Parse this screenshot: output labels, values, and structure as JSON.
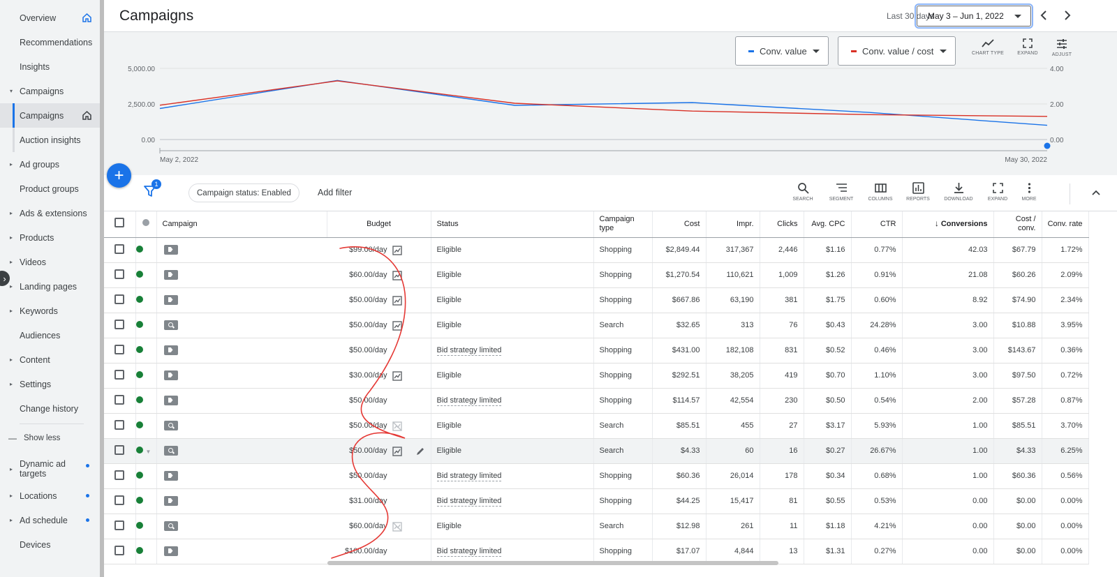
{
  "sidebar": {
    "items": [
      {
        "label": "Overview",
        "caret": false
      },
      {
        "label": "Recommendations",
        "caret": false
      },
      {
        "label": "Insights",
        "caret": false
      },
      {
        "label": "Campaigns",
        "caret": true,
        "expanded": true
      },
      {
        "label": "Campaigns",
        "caret": false,
        "active": true
      },
      {
        "label": "Auction insights",
        "caret": false
      },
      {
        "label": "Ad groups",
        "caret": true
      },
      {
        "label": "Product groups",
        "caret": false
      },
      {
        "label": "Ads & extensions",
        "caret": true
      },
      {
        "label": "Products",
        "caret": true
      },
      {
        "label": "Videos",
        "caret": true
      },
      {
        "label": "Landing pages",
        "caret": true
      },
      {
        "label": "Keywords",
        "caret": true
      },
      {
        "label": "Audiences",
        "caret": false
      },
      {
        "label": "Content",
        "caret": true
      },
      {
        "label": "Settings",
        "caret": true
      },
      {
        "label": "Change history",
        "caret": false
      }
    ],
    "show_less": "Show less",
    "lower_items": [
      {
        "label": "Dynamic ad targets",
        "dot": true
      },
      {
        "label": "Locations",
        "dot": true
      },
      {
        "label": "Ad schedule",
        "dot": true
      },
      {
        "label": "Devices",
        "dot": false
      }
    ]
  },
  "header": {
    "title": "Campaigns",
    "date_label": "Last 30 days",
    "date_range": "May 3 – Jun 1, 2022"
  },
  "chart_controls": {
    "metric1": "Conv. value",
    "metric1_color": "#1a73e8",
    "metric2": "Conv. value / cost",
    "metric2_color": "#d93025",
    "tools": [
      "CHART TYPE",
      "EXPAND",
      "ADJUST"
    ]
  },
  "chart_data": {
    "type": "line",
    "x_labels": [
      "May 2, 2022",
      "May 30, 2022"
    ],
    "x": [
      0,
      1,
      2,
      3,
      4,
      5
    ],
    "left_ticks": [
      "5,000.00",
      "2,500.00",
      "0.00"
    ],
    "right_ticks": [
      "4.00",
      "2.00",
      "0.00"
    ],
    "left_ylim": [
      0,
      5000
    ],
    "right_ylim": [
      0,
      4
    ],
    "series": [
      {
        "name": "Conv. value",
        "color": "#1a73e8",
        "axis": "left",
        "values": [
          2180,
          4150,
          2400,
          2600,
          1900,
          1000
        ]
      },
      {
        "name": "Conv. value / cost",
        "color": "#d93025",
        "axis": "right",
        "values": [
          1.93,
          3.3,
          2.04,
          1.6,
          1.4,
          1.3
        ]
      }
    ]
  },
  "toolbar": {
    "filter_count": "1",
    "chip": "Campaign status: Enabled",
    "add_filter": "Add filter",
    "tools": [
      "SEARCH",
      "SEGMENT",
      "COLUMNS",
      "REPORTS",
      "DOWNLOAD",
      "EXPAND",
      "MORE"
    ]
  },
  "table": {
    "headers": {
      "campaign": "Campaign",
      "budget": "Budget",
      "status": "Status",
      "type1": "Campaign",
      "type2": "type",
      "cost": "Cost",
      "impr": "Impr.",
      "clicks": "Clicks",
      "cpc": "Avg. CPC",
      "ctr": "CTR",
      "conversions": "Conversions",
      "cpconv1": "Cost /",
      "cpconv2": "conv.",
      "convrate": "Conv. rate"
    },
    "rows": [
      {
        "icon": "tag",
        "budget": "$99.00/day",
        "bicon": "chart",
        "status": "Eligible",
        "type": "Shopping",
        "cost": "$2,849.44",
        "impr": "317,367",
        "clicks": "2,446",
        "cpc": "$1.16",
        "ctr": "0.77%",
        "conv": "42.03",
        "cpconv": "$67.79",
        "rate": "1.72%"
      },
      {
        "icon": "tag",
        "budget": "$60.00/day",
        "bicon": "chart",
        "status": "Eligible",
        "type": "Shopping",
        "cost": "$1,270.54",
        "impr": "110,621",
        "clicks": "1,009",
        "cpc": "$1.26",
        "ctr": "0.91%",
        "conv": "21.08",
        "cpconv": "$60.26",
        "rate": "2.09%"
      },
      {
        "icon": "tag",
        "budget": "$50.00/day",
        "bicon": "chart",
        "status": "Eligible",
        "type": "Shopping",
        "cost": "$667.86",
        "impr": "63,190",
        "clicks": "381",
        "cpc": "$1.75",
        "ctr": "0.60%",
        "conv": "8.92",
        "cpconv": "$74.90",
        "rate": "2.34%"
      },
      {
        "icon": "search",
        "budget": "$50.00/day",
        "bicon": "chart",
        "status": "Eligible",
        "type": "Search",
        "cost": "$32.65",
        "impr": "313",
        "clicks": "76",
        "cpc": "$0.43",
        "ctr": "24.28%",
        "conv": "3.00",
        "cpconv": "$10.88",
        "rate": "3.95%"
      },
      {
        "icon": "tag",
        "budget": "$50.00/day",
        "bicon": "",
        "status": "Bid strategy limited",
        "type": "Shopping",
        "cost": "$431.00",
        "impr": "182,108",
        "clicks": "831",
        "cpc": "$0.52",
        "ctr": "0.46%",
        "conv": "3.00",
        "cpconv": "$143.67",
        "rate": "0.36%"
      },
      {
        "icon": "tag",
        "budget": "$30.00/day",
        "bicon": "chart",
        "status": "Eligible",
        "type": "Shopping",
        "cost": "$292.51",
        "impr": "38,205",
        "clicks": "419",
        "cpc": "$0.70",
        "ctr": "1.10%",
        "conv": "3.00",
        "cpconv": "$97.50",
        "rate": "0.72%"
      },
      {
        "icon": "tag",
        "budget": "$50.00/day",
        "bicon": "",
        "status": "Bid strategy limited",
        "type": "Shopping",
        "cost": "$114.57",
        "impr": "42,554",
        "clicks": "230",
        "cpc": "$0.50",
        "ctr": "0.54%",
        "conv": "2.00",
        "cpconv": "$57.28",
        "rate": "0.87%"
      },
      {
        "icon": "search",
        "budget": "$50.00/day",
        "bicon": "nochart",
        "status": "Eligible",
        "type": "Search",
        "cost": "$85.51",
        "impr": "455",
        "clicks": "27",
        "cpc": "$3.17",
        "ctr": "5.93%",
        "conv": "1.00",
        "cpconv": "$85.51",
        "rate": "3.70%"
      },
      {
        "icon": "search",
        "budget": "$50.00/day",
        "bicon": "chart",
        "status": "Eligible",
        "type": "Search",
        "cost": "$4.33",
        "impr": "60",
        "clicks": "16",
        "cpc": "$0.27",
        "ctr": "26.67%",
        "conv": "1.00",
        "cpconv": "$4.33",
        "rate": "6.25%",
        "hl": true
      },
      {
        "icon": "tag",
        "budget": "$50.00/day",
        "bicon": "",
        "status": "Bid strategy limited",
        "type": "Shopping",
        "cost": "$60.36",
        "impr": "26,014",
        "clicks": "178",
        "cpc": "$0.34",
        "ctr": "0.68%",
        "conv": "1.00",
        "cpconv": "$60.36",
        "rate": "0.56%"
      },
      {
        "icon": "tag",
        "budget": "$31.00/day",
        "bicon": "",
        "status": "Bid strategy limited",
        "type": "Shopping",
        "cost": "$44.25",
        "impr": "15,417",
        "clicks": "81",
        "cpc": "$0.55",
        "ctr": "0.53%",
        "conv": "0.00",
        "cpconv": "$0.00",
        "rate": "0.00%"
      },
      {
        "icon": "search",
        "budget": "$60.00/day",
        "bicon": "nochart",
        "status": "Eligible",
        "type": "Search",
        "cost": "$12.98",
        "impr": "261",
        "clicks": "11",
        "cpc": "$1.18",
        "ctr": "4.21%",
        "conv": "0.00",
        "cpconv": "$0.00",
        "rate": "0.00%"
      },
      {
        "icon": "tag",
        "budget": "$100.00/day",
        "bicon": "",
        "status": "Bid strategy limited",
        "type": "Shopping",
        "cost": "$17.07",
        "impr": "4,844",
        "clicks": "13",
        "cpc": "$1.31",
        "ctr": "0.27%",
        "conv": "0.00",
        "cpconv": "$0.00",
        "rate": "0.00%"
      }
    ]
  }
}
